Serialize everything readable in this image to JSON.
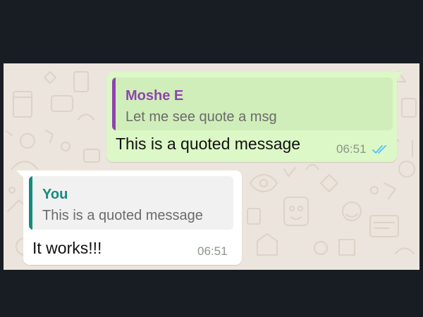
{
  "colors": {
    "frame_background": "#181d23",
    "chat_background": "#ece5dd",
    "outgoing_bubble": "#dcf8c6",
    "incoming_bubble": "#ffffff",
    "quote_accent_moshe": "#8e44ad",
    "quote_accent_you": "#128c7e",
    "read_ticks": "#4fc3f7"
  },
  "messages": [
    {
      "direction": "outgoing",
      "quote": {
        "author": "Moshe E",
        "text": "Let me see quote a msg"
      },
      "text": "This is a quoted message",
      "time": "06:51",
      "status_icon": "double-check-read-icon"
    },
    {
      "direction": "incoming",
      "quote": {
        "author": "You",
        "text": "This is a quoted message"
      },
      "text": "It works!!!",
      "time": "06:51"
    }
  ]
}
